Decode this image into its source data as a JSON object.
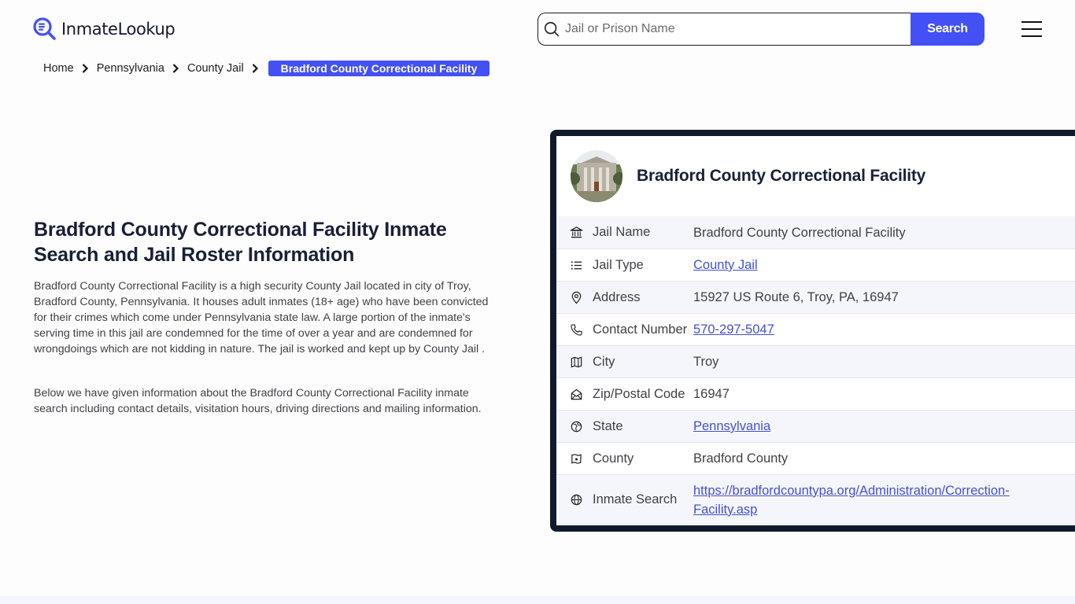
{
  "header": {
    "logo_text": "InmateLookup",
    "logo_icon": "magnifier-document-icon",
    "search": {
      "placeholder": "Jail or Prison Name",
      "value": "",
      "button_label": "Search"
    },
    "menu_icon": "hamburger-menu-icon"
  },
  "breadcrumb": {
    "items": [
      {
        "label": "Home"
      },
      {
        "label": "Pennsylvania"
      },
      {
        "label": "County Jail"
      }
    ],
    "current": "Bradford County Correctional Facility"
  },
  "main": {
    "title": "Bradford County Correctional Facility Inmate Search and Jail Roster Information",
    "paragraphs": [
      "Bradford County Correctional Facility is a high security County Jail located in city of Troy, Bradford County, Pennsylvania. It houses adult inmates (18+ age) who have been convicted for their crimes which come under Pennsylvania state law. A large portion of the inmate's serving time in this jail are condemned for the time of over a year and are condemned for wrongdoings which are not kidding in nature. The jail is worked and kept up by County Jail .",
      "Below we have given information about the Bradford County Correctional Facility inmate search including contact details, visitation hours, driving directions and mailing information."
    ]
  },
  "card": {
    "title": "Bradford County Correctional Facility",
    "image_alt": "facility-photo",
    "rows": [
      {
        "icon": "building-columns-icon",
        "label": "Jail Name",
        "value": "Bradford County Correctional Facility",
        "link": false
      },
      {
        "icon": "list-icon",
        "label": "Jail Type",
        "value": "County Jail",
        "link": true
      },
      {
        "icon": "map-pin-icon",
        "label": "Address",
        "value": "15927 US Route 6, Troy, PA, 16947",
        "link": false
      },
      {
        "icon": "phone-icon",
        "label": "Contact Number",
        "value": "570-297-5047",
        "link": true
      },
      {
        "icon": "map-icon",
        "label": "City",
        "value": "Troy",
        "link": false
      },
      {
        "icon": "mail-open-icon",
        "label": "Zip/Postal Code",
        "value": "16947",
        "link": false
      },
      {
        "icon": "globe-region-icon",
        "label": "State",
        "value": "Pennsylvania",
        "link": true
      },
      {
        "icon": "county-map-icon",
        "label": "County",
        "value": "Bradford County",
        "link": false
      },
      {
        "icon": "globe-icon",
        "label": "Inmate Search",
        "value": "https://bradfordcountypa.org/Administration/Correction-Facility.asp",
        "link": true
      }
    ]
  },
  "colors": {
    "accent": "#4350f5",
    "card_border": "#111a2c",
    "link": "#4350d4",
    "row_alt_bg": "#f5f6fb"
  }
}
